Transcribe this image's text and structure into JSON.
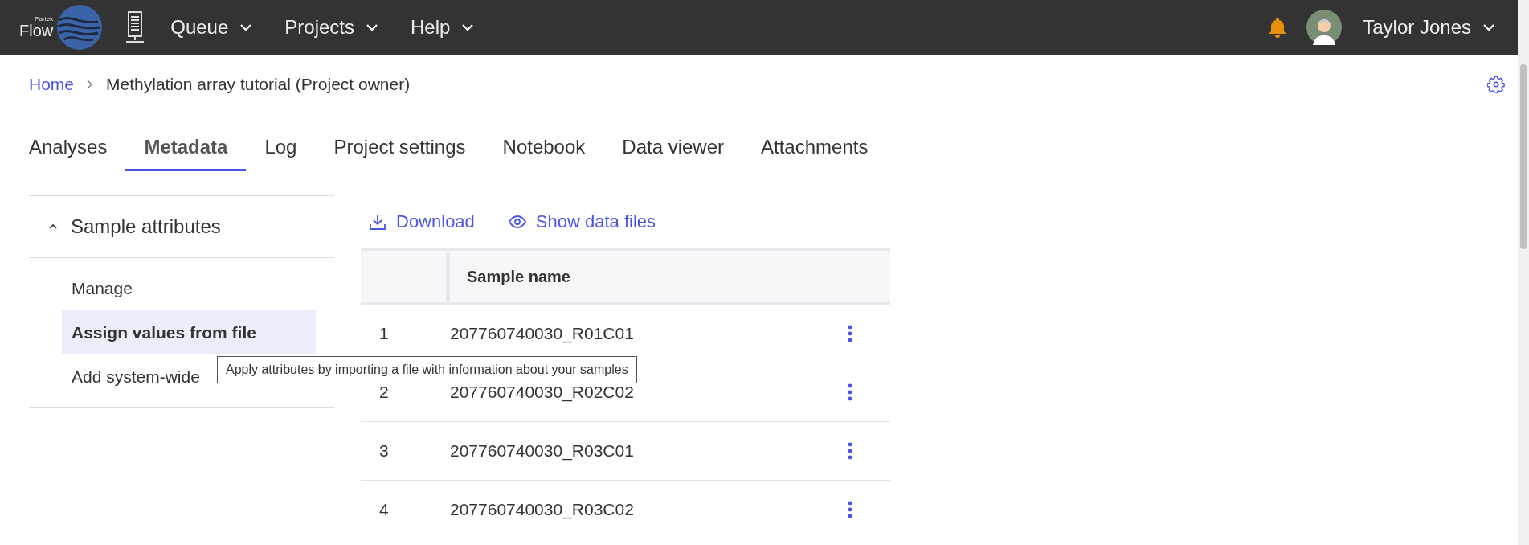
{
  "top_bar": {
    "logo": {
      "brand": "Partek",
      "product": "Flow"
    },
    "menus": [
      {
        "label": "Queue"
      },
      {
        "label": "Projects"
      },
      {
        "label": "Help"
      }
    ],
    "user": {
      "name": "Taylor Jones"
    }
  },
  "breadcrumb": {
    "home": "Home",
    "current": "Methylation array tutorial (Project owner)"
  },
  "tabs": [
    {
      "label": "Analyses",
      "selected": false
    },
    {
      "label": "Metadata",
      "selected": true
    },
    {
      "label": "Log",
      "selected": false
    },
    {
      "label": "Project settings",
      "selected": false
    },
    {
      "label": "Notebook",
      "selected": false
    },
    {
      "label": "Data viewer",
      "selected": false
    },
    {
      "label": "Attachments",
      "selected": false
    }
  ],
  "sidebar": {
    "section": {
      "label": "Sample attributes",
      "expanded": true
    },
    "items": [
      {
        "label": "Manage",
        "selected": false
      },
      {
        "label": "Assign values from file",
        "selected": true
      },
      {
        "label": "Add system-wide",
        "selected": false
      }
    ]
  },
  "toolbar": [
    {
      "kind": "download",
      "label": "Download"
    },
    {
      "kind": "view",
      "label": "Show data files"
    }
  ],
  "table": {
    "columns": [
      "Sample name"
    ],
    "rows": [
      {
        "index": "1",
        "name": "207760740030_R01C01"
      },
      {
        "index": "2",
        "name": "207760740030_R02C02"
      },
      {
        "index": "3",
        "name": "207760740030_R03C01"
      },
      {
        "index": "4",
        "name": "207760740030_R03C02"
      }
    ]
  },
  "tooltip": "Apply attributes by importing a file with information about your samples"
}
